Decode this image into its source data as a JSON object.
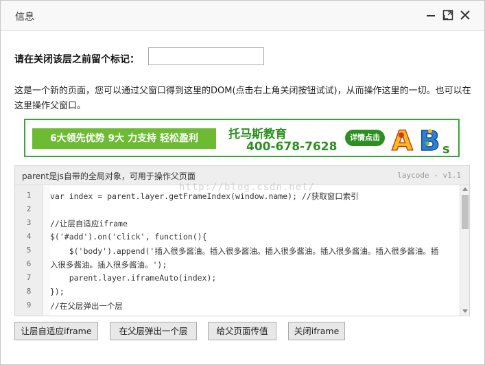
{
  "window": {
    "title": "信息"
  },
  "form": {
    "mark_label": "请在关闭该层之前留个标记：",
    "mark_value": ""
  },
  "description": "这是一个新的页面，您可以通过父窗口得到这里的DOM(点击右上角关闭按钮试试)，从而操作这里的一切。也可以在这里操作父窗口。",
  "banner": {
    "slogan": "6大领先优势 9大 力支持 轻松盈利",
    "brand": "托马斯教育",
    "phone": "400-678-7628",
    "detail": "详情点击",
    "letters": [
      "A",
      "B",
      "s"
    ]
  },
  "code": {
    "title": "parent是js自带的全局对象，可用于操作父页面",
    "version": "laycode - v1.1",
    "line_numbers": [
      "1",
      "2",
      "3",
      "4",
      "5",
      "6",
      "7",
      "8",
      "9"
    ],
    "lines": [
      "var index = parent.layer.getFrameIndex(window.name); //获取窗口索引",
      "",
      "//让层自适应iframe",
      "$('#add').on('click', function(){",
      "    $('body').append('插入很多酱油。插入很多酱油。插入很多酱油。插入很多酱油。插入很多酱油。插",
      "入很多酱油。插入很多酱油。');",
      "    parent.layer.iframeAuto(index);",
      "});",
      "//在父层弹出一个层"
    ]
  },
  "watermark": "http://blog.csdn.net/",
  "buttons": {
    "auto_iframe": "让层自适应iframe",
    "popup_parent": "在父层弹出一个层",
    "pass_value": "给父页面传值",
    "close_iframe": "关闭iframe"
  },
  "icons": {
    "minimize": "minimize-icon",
    "maximize": "maximize-icon",
    "close": "close-icon"
  },
  "colors": {
    "banner_green": "#37a535",
    "banner_light_green": "#6dbb33"
  }
}
